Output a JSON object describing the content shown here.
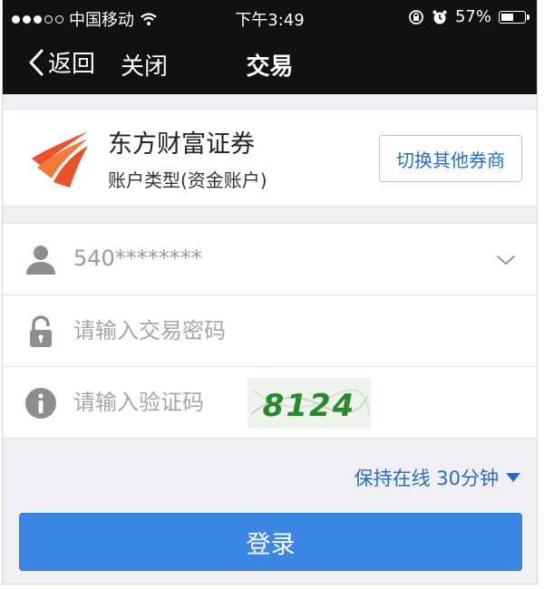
{
  "status_bar": {
    "carrier": "中国移动",
    "time": "下午3:49",
    "battery": "57%",
    "battery_level": 0.57
  },
  "nav": {
    "back_label": "返回",
    "close_label": "关闭",
    "title": "交易"
  },
  "broker": {
    "name": "东方财富证券",
    "account_type": "账户类型(资金账户)",
    "switch_label": "切换其他券商",
    "logo_colors": [
      "#e8532a",
      "#f07b3a"
    ]
  },
  "form": {
    "account_value": "540********",
    "password_placeholder": "请输入交易密码",
    "captcha_placeholder": "请输入验证码",
    "captcha_text": "8124"
  },
  "keep_online": "保持在线 30分钟",
  "login_label": "登录",
  "colors": {
    "accent": "#3b87e3",
    "link": "#2a6ebd",
    "bar": "#111111"
  }
}
